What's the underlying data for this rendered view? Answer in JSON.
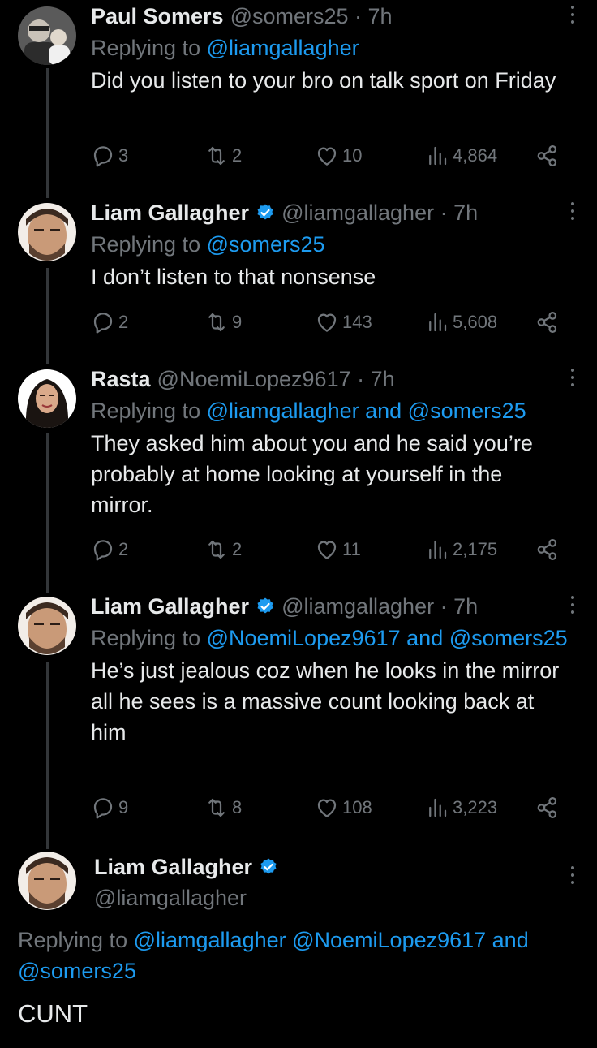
{
  "tweets": [
    {
      "name": "Paul Somers",
      "handle_time": "@somers25 · 7h",
      "reply_prefix": "Replying to",
      "reply_to": "@liamgallagher",
      "text": "Did you listen to your bro on talk sport on Friday",
      "replies": "3",
      "retweets": "2",
      "likes": "10",
      "views": "4,864",
      "verified": false
    },
    {
      "name": "Liam Gallagher",
      "handle_time": "@liamgallagher · 7h",
      "reply_prefix": "Replying to",
      "reply_to": "@somers25",
      "text": "I don’t listen to that nonsense",
      "replies": "2",
      "retweets": "9",
      "likes": "143",
      "views": "5,608",
      "verified": true
    },
    {
      "name": "Rasta",
      "handle_time": "@NoemiLopez9617 · 7h",
      "reply_prefix": "Replying to",
      "reply_to": "@liamgallagher and @somers25",
      "text": "They asked him about you and he said you’re probably at home looking at yourself in the mirror.",
      "replies": "2",
      "retweets": "2",
      "likes": "11",
      "views": "2,175",
      "verified": false
    },
    {
      "name": "Liam Gallagher",
      "handle_time": "@liamgallagher · 7h",
      "reply_prefix": "Replying to",
      "reply_to": "@NoemiLopez9617 and @somers25",
      "text": "He’s just jealous coz when he looks in the mirror all he sees is a massive count looking back at him",
      "replies": "9",
      "retweets": "8",
      "likes": "108",
      "views": "3,223",
      "verified": true
    }
  ],
  "focused": {
    "name": "Liam Gallagher",
    "handle": "@liamgallagher",
    "reply_prefix": "Replying to",
    "reply_to": "@liamgallagher @NoemiLopez9617 and @somers25",
    "text": "CUNT",
    "verified": true
  },
  "colors": {
    "background": "#000000",
    "primary_text": "#e7e9ea",
    "secondary_text": "#71767b",
    "link": "#1d9bf0",
    "verified": "#1d9bf0"
  },
  "icons": {
    "reply": "reply-icon",
    "retweet": "retweet-icon",
    "like": "like-icon",
    "views": "views-icon",
    "share": "share-icon",
    "more": "more-icon",
    "verified": "verified-icon"
  }
}
